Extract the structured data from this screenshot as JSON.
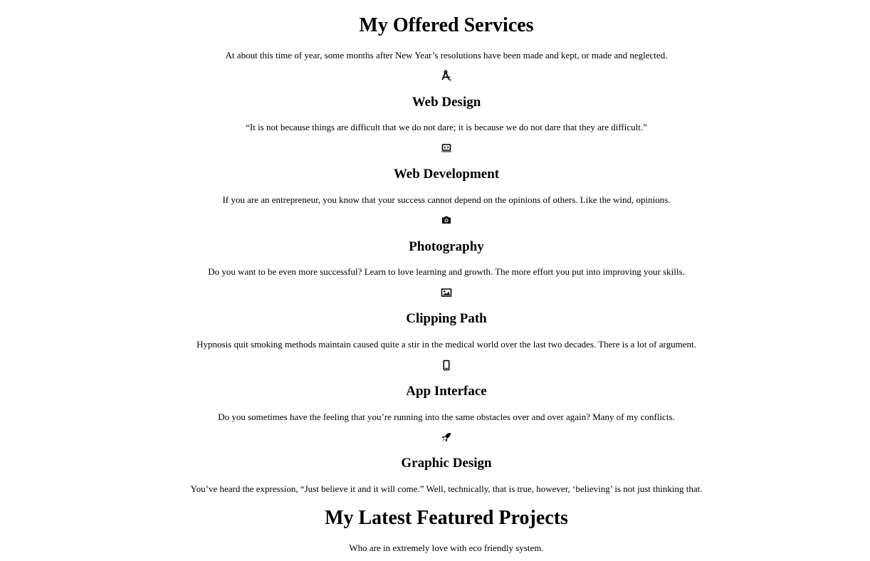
{
  "services_section": {
    "title": "My Offered Services",
    "intro": "At about this time of year, some months after New Year’s resolutions have been made and kept, or made and neglected."
  },
  "services": [
    {
      "icon": "compass-drafting-icon",
      "title": "Web Design",
      "description": "“It is not because things are difficult that we do not dare; it is because we do not dare that they are difficult.”"
    },
    {
      "icon": "laptop-code-icon",
      "title": "Web Development",
      "description": "If you are an entrepreneur, you know that your success cannot depend on the opinions of others. Like the wind, opinions."
    },
    {
      "icon": "camera-icon",
      "title": "Photography",
      "description": "Do you want to be even more successful? Learn to love learning and growth. The more effort you put into improving your skills."
    },
    {
      "icon": "image-icon",
      "title": "Clipping Path",
      "description": "Hypnosis quit smoking methods maintain caused quite a stir in the medical world over the last two decades. There is a lot of argument."
    },
    {
      "icon": "mobile-icon",
      "title": "App Interface",
      "description": "Do you sometimes have the feeling that you’re running into the same obstacles over and over again? Many of my conflicts."
    },
    {
      "icon": "rocket-icon",
      "title": "Graphic Design",
      "description": "You’ve heard the expression, “Just believe it and it will come.” Well, technically, that is true, however, ‘believing’ is not just thinking that."
    }
  ],
  "projects_section": {
    "title": "My Latest Featured Projects",
    "intro": "Who are in extremely love with eco friendly system."
  }
}
